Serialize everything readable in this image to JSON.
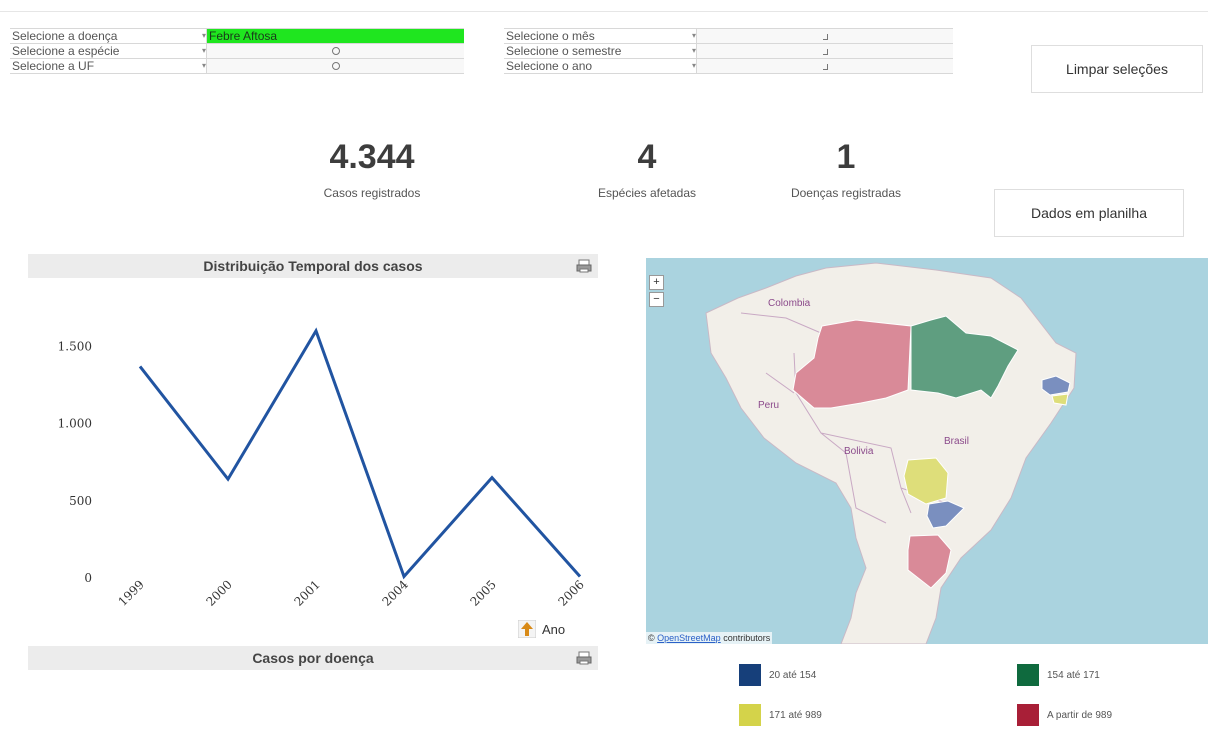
{
  "filters_left": [
    {
      "label": "Selecione a doença",
      "value": "Febre Aftosa",
      "selected": true
    },
    {
      "label": "Selecione a espécie",
      "value": "",
      "selected": false
    },
    {
      "label": "Selecione a UF",
      "value": "",
      "selected": false
    }
  ],
  "filters_right": [
    {
      "label": "Selecione o mês"
    },
    {
      "label": "Selecione o semestre"
    },
    {
      "label": "Selecione o ano"
    }
  ],
  "buttons": {
    "clear": "Limpar seleções",
    "spreadsheet": "Dados em planilha"
  },
  "kpis": [
    {
      "value": "4.344",
      "label": "Casos registrados"
    },
    {
      "value": "4",
      "label": "Espécies afetadas"
    },
    {
      "value": "1",
      "label": "Doenças registradas"
    }
  ],
  "panels": {
    "temporal_title": "Distribuição Temporal dos casos",
    "disease_title": "Casos por doença"
  },
  "sort": {
    "label": "Ano"
  },
  "chart_data": {
    "type": "line",
    "categories": [
      "1999",
      "2000",
      "2001",
      "2004",
      "2005",
      "2006"
    ],
    "values": [
      1370,
      640,
      1600,
      10,
      650,
      10
    ],
    "ylim": [
      0,
      1800
    ],
    "yticks": [
      0,
      500,
      1000,
      1500
    ],
    "ytick_labels": [
      "0",
      "500",
      "1.000",
      "1.500"
    ],
    "xlabel": "",
    "ylabel": "",
    "grid": false,
    "color": "#2154a1"
  },
  "map": {
    "countries": [
      "Colombia",
      "Peru",
      "Bolivia",
      "Brasil"
    ],
    "attribution_prefix": "©",
    "attribution_link": "OpenStreetMap",
    "attribution_suffix": "contributors",
    "zoom_in": "+",
    "zoom_out": "−"
  },
  "legend": [
    {
      "label": "20 até 154",
      "color": "#163f7a"
    },
    {
      "label": "154 até 171",
      "color": "#0f6a3e"
    },
    {
      "label": "171 até 989",
      "color": "#d4d34a"
    },
    {
      "label": "A partir de 989",
      "color": "#a81f37"
    }
  ],
  "colors": {
    "selected_filter": "#1fe61f",
    "panel_header": "#ececec",
    "line": "#2154a1",
    "ocean": "#aad3df"
  }
}
